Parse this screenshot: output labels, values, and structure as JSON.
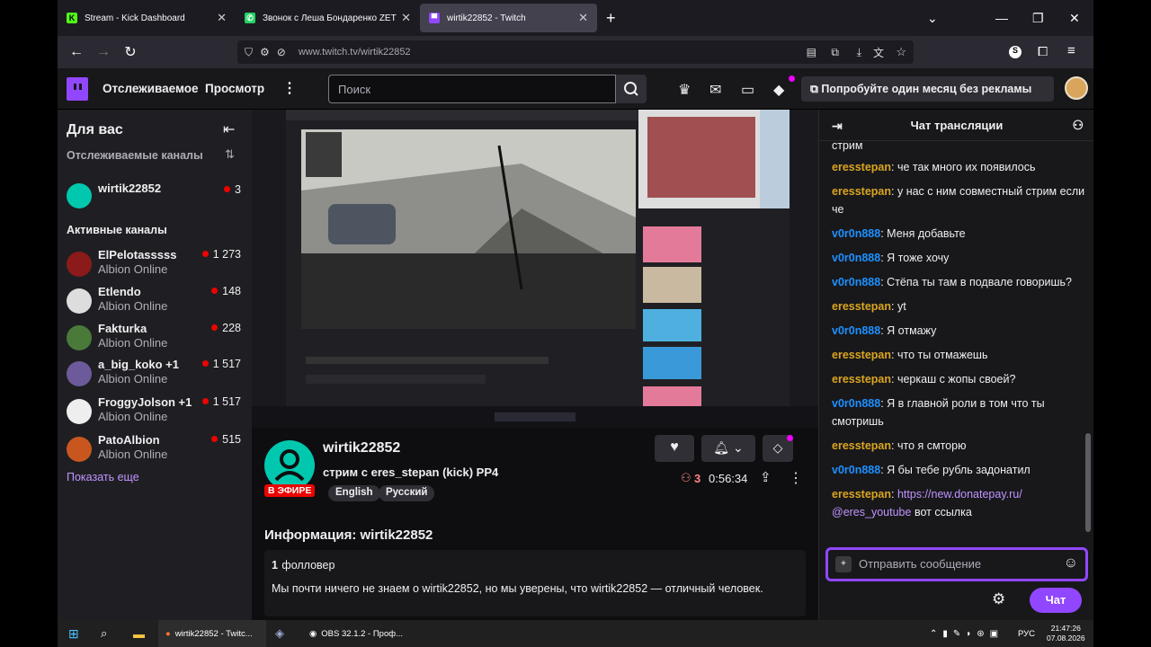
{
  "browser": {
    "tabs": [
      {
        "title": "Stream - Kick Dashboard",
        "favicon": "kick-icon",
        "color": "#53fc18"
      },
      {
        "title": "Звонок с Леша Бондаренко ZET",
        "favicon": "whatsapp-icon",
        "color": "#25d366"
      },
      {
        "title": "wirtik22852 - Twitch",
        "favicon": "twitch-icon",
        "color": "#9147ff"
      }
    ],
    "url": "www.twitch.tv/wirtik22852"
  },
  "twitch_header": {
    "following": "Отслеживаемое",
    "browse": "Просмотр",
    "search_placeholder": "Поиск",
    "ad_free": "Попробуйте один месяц без рекламы"
  },
  "sidebar": {
    "title": "Для вас",
    "followed_label": "Отслеживаемые каналы",
    "followed": [
      {
        "name": "wirtik22852",
        "viewers": "3"
      }
    ],
    "active_label": "Активные каналы",
    "channels": [
      {
        "name": "ElPelotasssss",
        "game": "Albion Online",
        "viewers": "1 273",
        "color": "#8b1a1a"
      },
      {
        "name": "Etlendo",
        "game": "Albion Online",
        "viewers": "148",
        "color": "#ddd"
      },
      {
        "name": "Fakturka",
        "game": "Albion Online",
        "viewers": "228",
        "color": "#4a7a3a"
      },
      {
        "name": "a_big_koko +1",
        "game": "Albion Online",
        "viewers": "1 517",
        "color": "#6d5a9a"
      },
      {
        "name": "FroggyJolson +1",
        "game": "Albion Online",
        "viewers": "1 517",
        "color": "#eee"
      },
      {
        "name": "PatoAlbion",
        "game": "Albion Online",
        "viewers": "515",
        "color": "#c8561e"
      }
    ],
    "show_more": "Показать еще"
  },
  "stream": {
    "channel": "wirtik22852",
    "title": "стрим с eres_stepan (kick) PP4",
    "live_badge": "В ЭФИРЕ",
    "tags": [
      "English",
      "Русский"
    ],
    "viewers": "3",
    "uptime": "0:56:34",
    "about_title": "Информация: wirtik22852",
    "followers_count": "1",
    "followers_label": "фолловер",
    "bio": "Мы почти ничего не знаем о wirtik22852, но мы уверены, что wirtik22852 — отличный человек."
  },
  "chat": {
    "title": "Чат трансляции",
    "cut_line": "стрим",
    "messages": [
      {
        "user": "eresstepan",
        "text": "че так много их появилось",
        "color": "#daa520"
      },
      {
        "user": "eresstepan",
        "text": "у нас с ним совместный стрим если че",
        "color": "#daa520"
      },
      {
        "user": "v0r0n888",
        "text": "Меня добавьте",
        "color": "#1e90ff"
      },
      {
        "user": "v0r0n888",
        "text": "Я тоже хочу",
        "color": "#1e90ff"
      },
      {
        "user": "v0r0n888",
        "text": "Стёпа ты там в подвале говоришь?",
        "color": "#1e90ff"
      },
      {
        "user": "eresstepan",
        "text": "yt",
        "color": "#daa520"
      },
      {
        "user": "v0r0n888",
        "text": "Я отмажу",
        "color": "#1e90ff"
      },
      {
        "user": "eresstepan",
        "text": "что ты отмажешь",
        "color": "#daa520"
      },
      {
        "user": "eresstepan",
        "text": "черкаш с жопы своей?",
        "color": "#daa520"
      },
      {
        "user": "v0r0n888",
        "text": "Я в главной роли в том что ты смотришь",
        "color": "#1e90ff"
      },
      {
        "user": "eresstepan",
        "text": "что я смторю",
        "color": "#daa520"
      },
      {
        "user": "v0r0n888",
        "text": "Я бы тебе рубль задонатил",
        "color": "#1e90ff"
      }
    ],
    "last": {
      "user": "eresstepan",
      "link": "https://new.donatepay.ru/",
      "mention": "@eres_youtube",
      "text": "вот ссылка"
    },
    "input_placeholder": "Отправить сообщение",
    "send": "Чат"
  },
  "taskbar": {
    "apps": [
      "wirtik22852 - Twitc...",
      "OBS 32.1.2 - Проф..."
    ],
    "lang": "РУС",
    "time": "21:47:26",
    "date": "07.08.2026"
  }
}
